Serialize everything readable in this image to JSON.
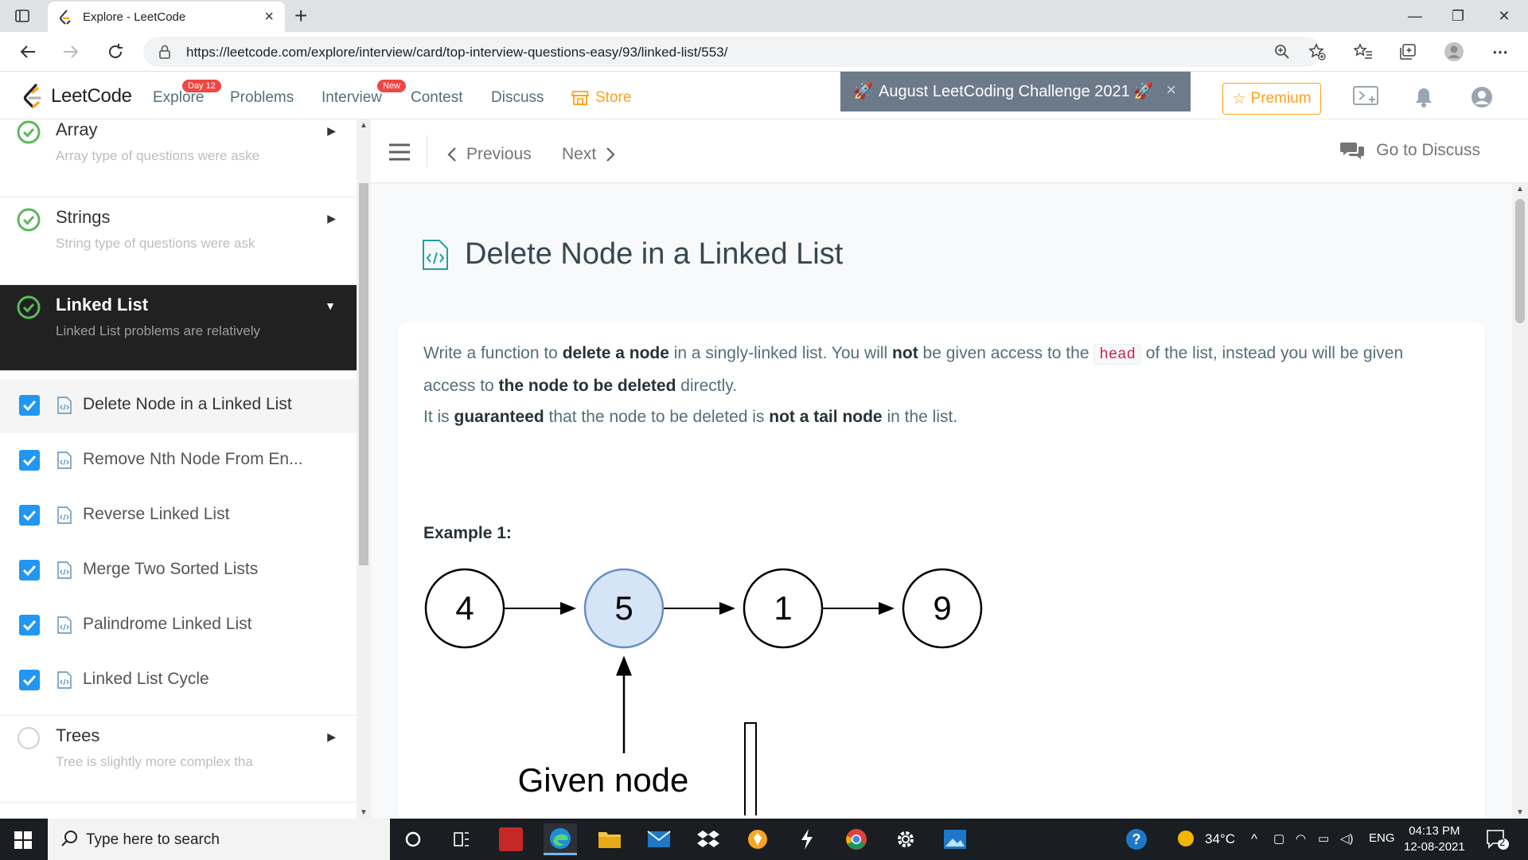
{
  "browser": {
    "tab_title": "Explore - LeetCode",
    "url": "https://leetcode.com/explore/interview/card/top-interview-questions-easy/93/linked-list/553/"
  },
  "header": {
    "logo": "LeetCode",
    "nav": [
      {
        "label": "Explore",
        "badge": "Day 12"
      },
      {
        "label": "Problems",
        "badge": ""
      },
      {
        "label": "Interview",
        "badge": "New"
      },
      {
        "label": "Contest",
        "badge": ""
      },
      {
        "label": "Discuss",
        "badge": ""
      },
      {
        "label": "Store",
        "badge": ""
      }
    ],
    "challenge": "August LeetCoding Challenge 2021",
    "premium": "Premium",
    "colors": {
      "accent": "#ffa116",
      "badge": "#ef4743"
    }
  },
  "sidebar": {
    "chapters": [
      {
        "name": "Array",
        "desc": "Array type of questions were aske",
        "done": true
      },
      {
        "name": "Strings",
        "desc": "String type of questions were ask",
        "done": true
      },
      {
        "name": "Linked List",
        "desc": "Linked List problems are relatively",
        "done": true
      },
      {
        "name": "Trees",
        "desc": "Tree is slightly more complex tha",
        "done": false
      }
    ],
    "items": [
      {
        "label": "Delete Node in a Linked List"
      },
      {
        "label": "Remove Nth Node From En..."
      },
      {
        "label": "Reverse Linked List"
      },
      {
        "label": "Merge Two Sorted Lists"
      },
      {
        "label": "Palindrome Linked List"
      },
      {
        "label": "Linked List Cycle"
      }
    ]
  },
  "toolbar": {
    "previous": "Previous",
    "next": "Next",
    "discuss": "Go to Discuss"
  },
  "question": {
    "title": "Delete Node in a Linked List",
    "p1": {
      "t1": "Write a function to ",
      "b1": "delete a node",
      "t2": " in a singly-linked list. You will ",
      "b2": "not",
      "t3": " be given access to the ",
      "code": "head",
      "t4": " of the list, instead you will be given access to ",
      "b3": "the node to be deleted",
      "t5": " directly."
    },
    "p2": {
      "t1": "It is ",
      "b1": "guaranteed",
      "t2": " that the node to be deleted is ",
      "b2": "not a tail node",
      "t3": " in the list."
    },
    "example_label": "Example 1:",
    "diagram": {
      "nodes": [
        "4",
        "5",
        "1",
        "9"
      ],
      "highlight_index": 1,
      "pointer_label": "Given node",
      "highlight_color": "#d6e4f7"
    }
  },
  "taskbar": {
    "search_placeholder": "Type here to search",
    "weather": "34°C",
    "lang": "ENG",
    "time": "04:13 PM",
    "date": "12-08-2021",
    "notifications": "2"
  }
}
